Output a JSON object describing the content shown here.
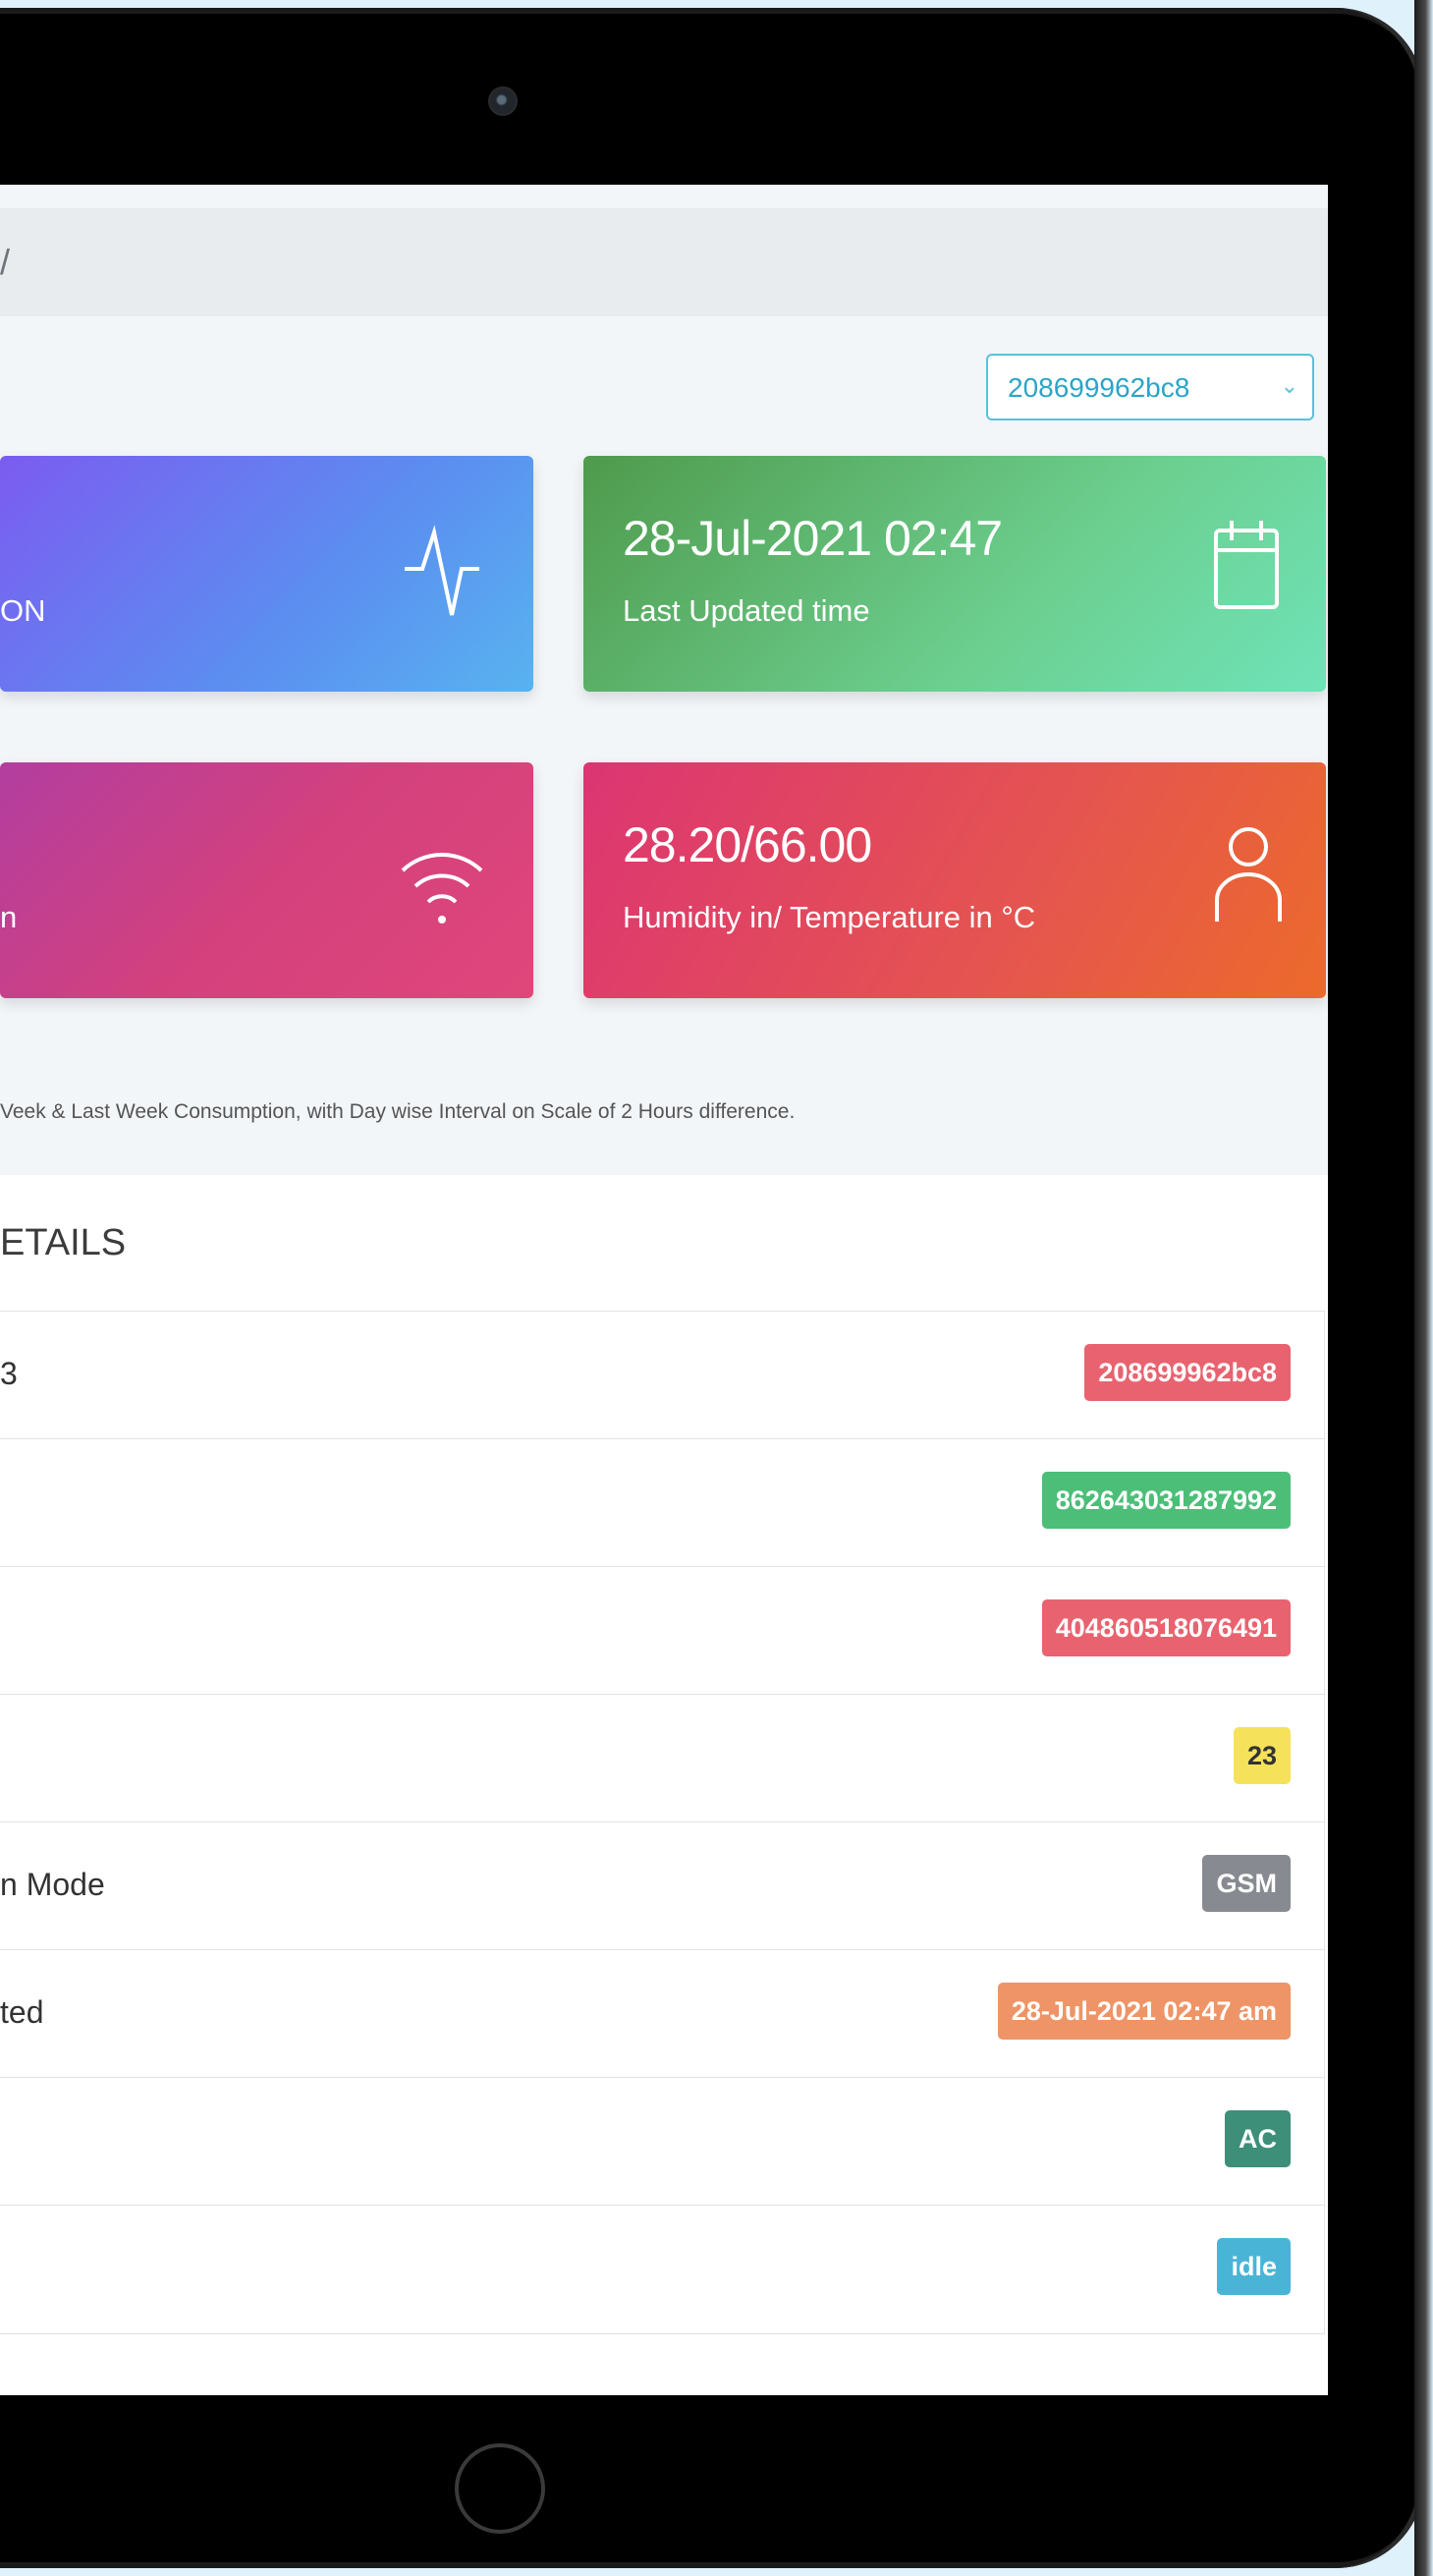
{
  "breadcrumb": "/",
  "device_select": {
    "selected": "208699962bc8"
  },
  "cards": [
    {
      "id": "power",
      "value": "",
      "label": "ON",
      "icon": "pulse-icon"
    },
    {
      "id": "last-updated",
      "value": "28-Jul-2021 02:47",
      "label": "Last Updated time",
      "icon": "calendar-icon"
    },
    {
      "id": "signal",
      "value": "",
      "label": "n",
      "icon": "wifi-icon"
    },
    {
      "id": "humidity",
      "value": "28.20/66.00",
      "label": "Humidity in/ Temperature in °C",
      "icon": "user-icon"
    }
  ],
  "note": "Veek & Last Week Consumption, with Day wise Interval on Scale of 2 Hours difference.",
  "details": {
    "title": "ETAILS",
    "rows": [
      {
        "label": "3",
        "badge": "208699962bc8",
        "color": "#e8636f"
      },
      {
        "label": "",
        "badge": "862643031287992",
        "color": "#4cbe78"
      },
      {
        "label": "",
        "badge": "404860518076491",
        "color": "#e8636f"
      },
      {
        "label": "",
        "badge": "23",
        "color": "#f6e15a"
      },
      {
        "label": "n Mode",
        "badge": "GSM",
        "color": "#878b91"
      },
      {
        "label": "ted",
        "badge": "28-Jul-2021 02:47 am",
        "color": "#ee9466"
      },
      {
        "label": "",
        "badge": "AC",
        "color": "#3d8f7a"
      },
      {
        "label": "",
        "badge": "idle",
        "color": "#4ab4d6"
      }
    ]
  }
}
